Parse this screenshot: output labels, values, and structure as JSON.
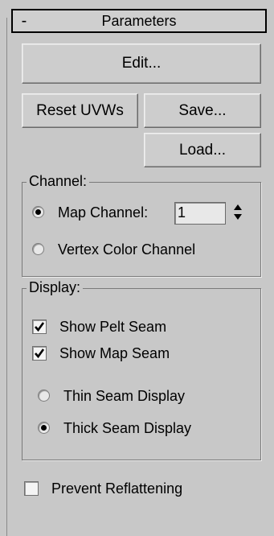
{
  "rollout": {
    "collapse_symbol": "-",
    "title": "Parameters"
  },
  "buttons": {
    "edit": "Edit...",
    "reset_uvws": "Reset UVWs",
    "save": "Save...",
    "load": "Load..."
  },
  "channel": {
    "title": "Channel:",
    "map_channel_label": "Map Channel:",
    "map_channel_value": "1",
    "map_channel_selected": true,
    "vertex_color_label": "Vertex Color Channel",
    "vertex_color_selected": false
  },
  "display": {
    "title": "Display:",
    "show_pelt_seam": {
      "label": "Show Pelt Seam",
      "checked": true
    },
    "show_map_seam": {
      "label": "Show Map Seam",
      "checked": true
    },
    "thin_seam": {
      "label": "Thin Seam Display",
      "selected": false
    },
    "thick_seam": {
      "label": "Thick Seam Display",
      "selected": true
    }
  },
  "prevent_reflattening": {
    "label": "Prevent Reflattening",
    "checked": false
  },
  "icons": {
    "radio_on": "radio-selected-icon",
    "radio_off": "radio-empty-icon",
    "check_on": "checkmark-icon",
    "spinner": "spinner-arrows-icon"
  }
}
